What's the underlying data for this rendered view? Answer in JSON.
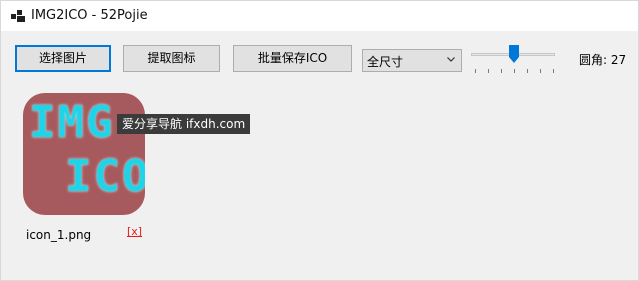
{
  "window": {
    "title": "IMG2ICO - 52Pojie"
  },
  "toolbar": {
    "select_image_label": "选择图片",
    "extract_icon_label": "提取图标",
    "batch_save_label": "批量保存ICO"
  },
  "size_select": {
    "value": "全尺寸"
  },
  "corner_radius": {
    "label": "圆角: 27",
    "value": 27
  },
  "thumbnail": {
    "image_text_line1": "IMG",
    "image_text_line2": "ICO",
    "filename": "icon_1.png",
    "remove_label": "[x]"
  },
  "tooltip": {
    "text": "爱分享导航 ifxdh.com"
  },
  "colors": {
    "accent": "#0078d7",
    "thumb_bg": "#a65a5e",
    "thumb_text": "#1ed4e8",
    "remove": "#e02020"
  }
}
